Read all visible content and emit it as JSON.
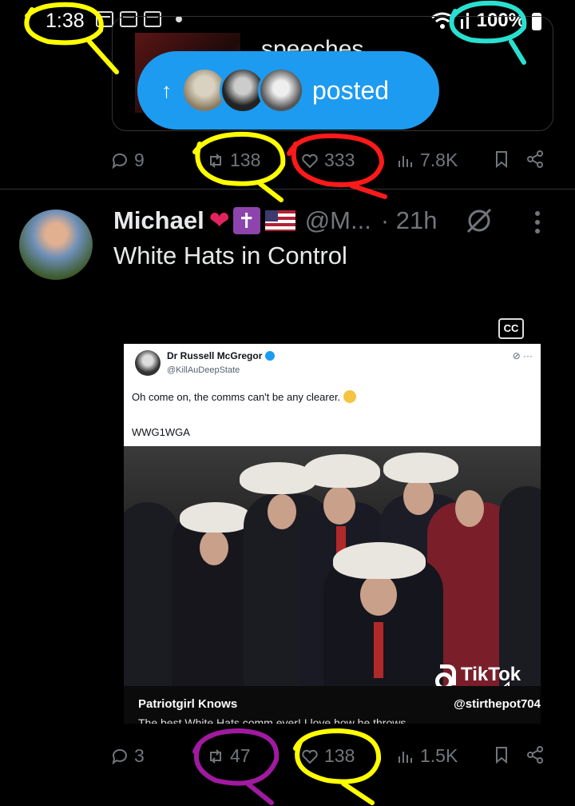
{
  "status_bar": {
    "time": "1:38",
    "battery": "100%"
  },
  "prev_tweet": {
    "quote_text": "speeches",
    "pill_label": "posted",
    "actions": {
      "replies": "9",
      "reposts": "138",
      "likes": "333",
      "views": "7.8K"
    }
  },
  "tweet": {
    "author": "Michael",
    "handle": "@M...",
    "time": "· 21h",
    "text": "White Hats in Control",
    "cc_label": "CC",
    "media": {
      "inner_name": "Dr Russell McGregor",
      "inner_handle": "@KillAuDeepState",
      "inner_text": "Oh come on, the comms can't be any clearer.",
      "inner_tag": "WWG1WGA",
      "tiktok_label": "TikTok",
      "caption_left": "Patriotgirl Knows",
      "caption_right": "@stirthepot704",
      "caption_sub": "The best White Hats comm ever! I love how he throws"
    },
    "actions": {
      "replies": "3",
      "reposts": "47",
      "likes": "138",
      "views": "1.5K"
    }
  },
  "colors": {
    "background": "#000000",
    "accent": "#1d9bf0",
    "secondary_text": "#71767b",
    "annotation_yellow": "#ffff00",
    "annotation_red": "#ff1a1a",
    "annotation_cyan": "#29e0d0",
    "annotation_purple": "#a01aa0"
  }
}
